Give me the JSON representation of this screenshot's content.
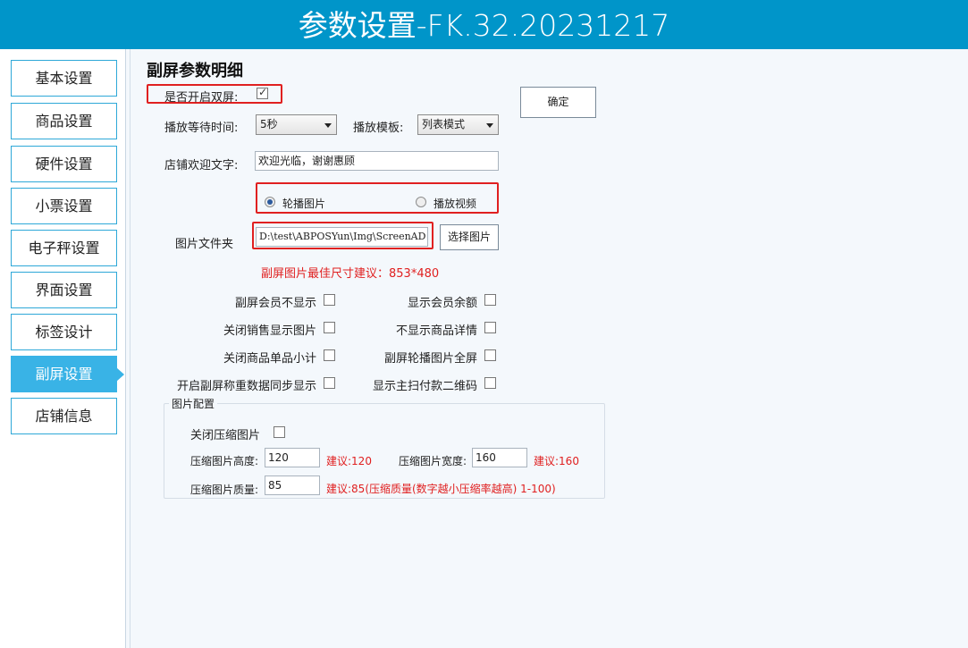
{
  "window": {
    "title": "参数设置-FK.32.20231217"
  },
  "sidebar": {
    "items": [
      {
        "label": "基本设置",
        "active": false
      },
      {
        "label": "商品设置",
        "active": false
      },
      {
        "label": "硬件设置",
        "active": false
      },
      {
        "label": "小票设置",
        "active": false
      },
      {
        "label": "电子秤设置",
        "active": false
      },
      {
        "label": "界面设置",
        "active": false
      },
      {
        "label": "标签设计",
        "active": false
      },
      {
        "label": "副屏设置",
        "active": true
      },
      {
        "label": "店铺信息",
        "active": false
      }
    ]
  },
  "main": {
    "title": "副屏参数明细",
    "dual_screen": {
      "label": "是否开启双屏:",
      "checked": true
    },
    "confirm_button": "确定",
    "wait_time": {
      "label": "播放等待时间:",
      "value": "5秒"
    },
    "play_template": {
      "label": "播放模板:",
      "value": "列表模式"
    },
    "welcome": {
      "label": "店铺欢迎文字:",
      "value": "欢迎光临，谢谢惠顾"
    },
    "play_mode": {
      "option_images": "轮播图片",
      "option_video": "播放视频",
      "selected": "轮播图片"
    },
    "folder": {
      "label": "图片文件夹",
      "value": "D:\\test\\ABPOSYun\\Img\\ScreenAD",
      "button": "选择图片"
    },
    "size_hint": "副屏图片最佳尺寸建议：853*480",
    "options": [
      {
        "label": "副屏会员不显示",
        "checked": false
      },
      {
        "label": "显示会员余额",
        "checked": false
      },
      {
        "label": "关闭销售显示图片",
        "checked": false
      },
      {
        "label": "不显示商品详情",
        "checked": false
      },
      {
        "label": "关闭商品单品小计",
        "checked": false
      },
      {
        "label": "副屏轮播图片全屏",
        "checked": false
      },
      {
        "label": "开启副屏称重数据同步显示",
        "checked": false
      },
      {
        "label": "显示主扫付款二维码",
        "checked": false
      }
    ],
    "image_config": {
      "group_title": "图片配置",
      "close_compress": {
        "label": "关闭压缩图片",
        "checked": false
      },
      "height": {
        "label": "压缩图片高度:",
        "value": "120",
        "hint": "建议:120"
      },
      "width": {
        "label": "压缩图片宽度:",
        "value": "160",
        "hint": "建议:160"
      },
      "quality": {
        "label": "压缩图片质量:",
        "value": "85",
        "hint": "建议:85(压缩质量(数字越小压缩率越高) 1-100)"
      }
    }
  },
  "colors": {
    "titlebar": "#0095c9",
    "nav_active": "#39b3e6",
    "nav_border": "#2ea8d8",
    "highlight": "#e02020"
  }
}
